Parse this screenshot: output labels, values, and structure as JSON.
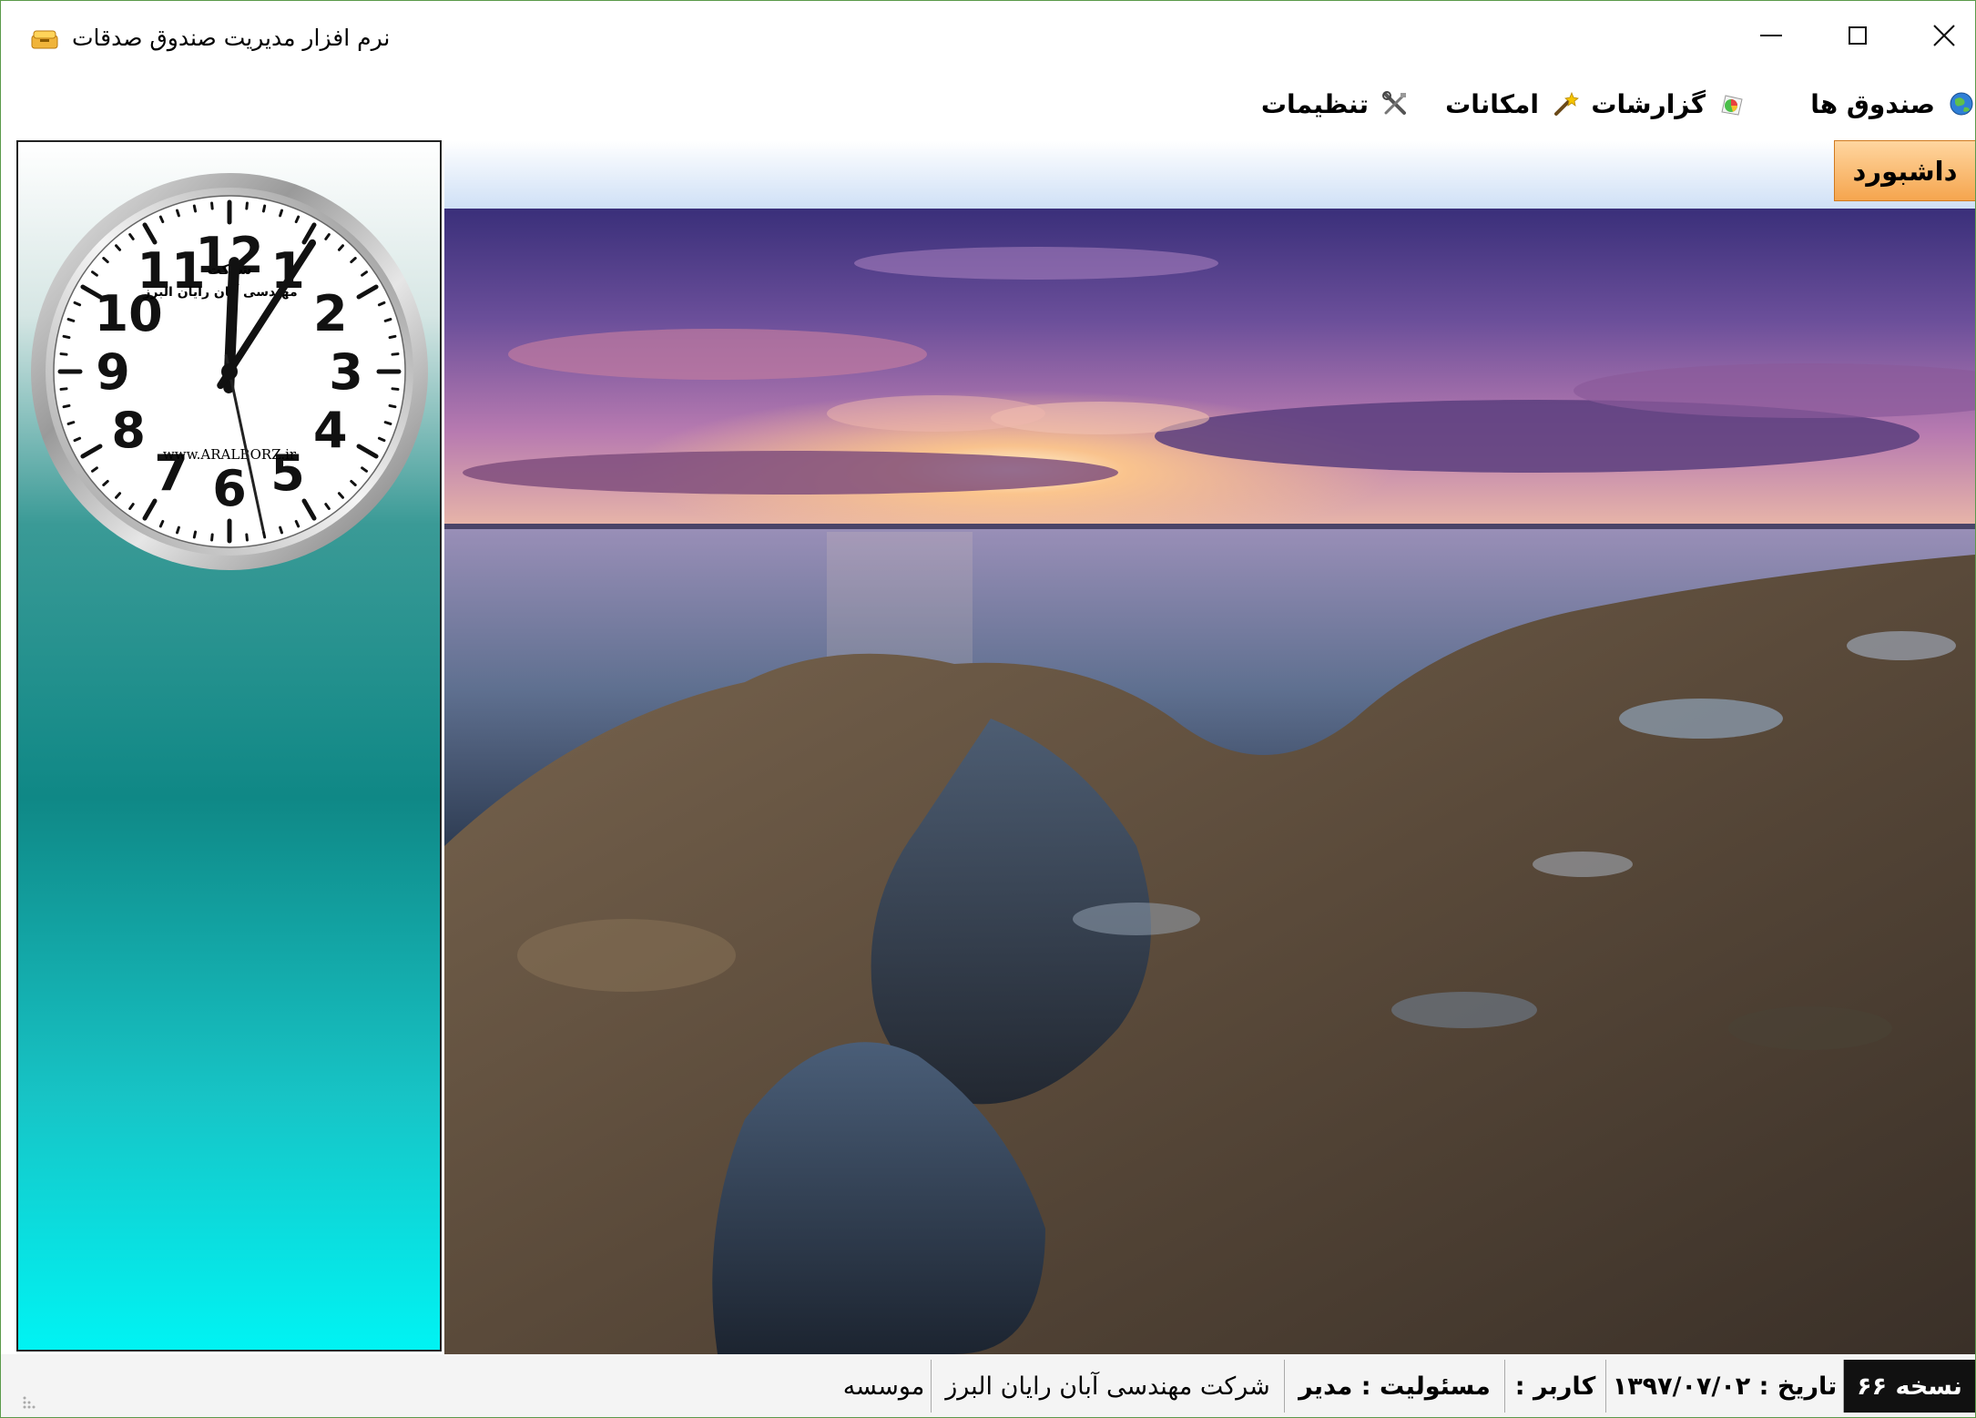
{
  "window": {
    "title": "نرم افزار مدیریت صندوق صدقات",
    "minimize": "–",
    "maximize": "☐",
    "close": "✕"
  },
  "menu": {
    "items": [
      {
        "label": "صندوق ها",
        "icon": "globe-icon"
      },
      {
        "label": "گزارشات",
        "icon": "chart-icon"
      },
      {
        "label": "امکانات",
        "icon": "magic-wand-icon"
      },
      {
        "label": "تنظیمات",
        "icon": "tools-icon"
      }
    ]
  },
  "clock": {
    "brand_line1": "شرکت",
    "brand_line2": "مهندسی آبان رایان البرز",
    "website": "www.ARALBORZ.ir",
    "numerals": [
      "12",
      "1",
      "2",
      "3",
      "4",
      "5",
      "6",
      "7",
      "8",
      "9",
      "10",
      "11"
    ],
    "time": "12:05:28"
  },
  "tabs": {
    "dashboard": "داشبورد"
  },
  "photo": {
    "description": "sea-sunset-rocks"
  },
  "status": {
    "version": "نسخه ۶۶",
    "date": "تاریخ : ۱۳۹۷/۰۷/۰۲",
    "user": "کاربر :",
    "role": "مسئولیت : مدیر",
    "company": "شرکت مهندسی آبان رایان البرز",
    "institute": "موسسه"
  }
}
